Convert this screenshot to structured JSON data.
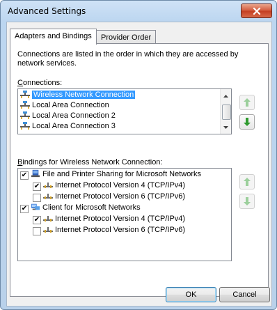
{
  "window": {
    "title": "Advanced Settings"
  },
  "tabs": [
    {
      "label": "Adapters and Bindings"
    },
    {
      "label": "Provider Order"
    }
  ],
  "intro_text": "Connections are listed in the order in which they are accessed by network services.",
  "connections": {
    "label_accel": "C",
    "label_rest": "onnections:",
    "items": [
      {
        "label": "Wireless Network Connection",
        "selected": true
      },
      {
        "label": "Local Area Connection",
        "selected": false
      },
      {
        "label": "Local Area Connection 2",
        "selected": false
      },
      {
        "label": "Local Area Connection 3",
        "selected": false
      }
    ]
  },
  "bindings": {
    "label_accel": "B",
    "label_rest": "indings for Wireless Network Connection:",
    "items": [
      {
        "label": "File and Printer Sharing for Microsoft Networks",
        "checked": true,
        "level": 0,
        "icon": "file-printer-sharing-icon"
      },
      {
        "label": "Internet Protocol Version 4 (TCP/IPv4)",
        "checked": true,
        "level": 1,
        "icon": "protocol-icon"
      },
      {
        "label": "Internet Protocol Version 6 (TCP/IPv6)",
        "checked": false,
        "level": 1,
        "icon": "protocol-icon"
      },
      {
        "label": "Client for Microsoft Networks",
        "checked": true,
        "level": 0,
        "icon": "network-client-icon"
      },
      {
        "label": "Internet Protocol Version 4 (TCP/IPv4)",
        "checked": true,
        "level": 1,
        "icon": "protocol-icon"
      },
      {
        "label": "Internet Protocol Version 6 (TCP/IPv6)",
        "checked": false,
        "level": 1,
        "icon": "protocol-icon"
      }
    ]
  },
  "buttons": {
    "ok": "OK",
    "cancel": "Cancel"
  },
  "colors": {
    "selection": "#3399ff",
    "arrow_green": "#2e9a2e",
    "close_red": "#c33d21"
  }
}
